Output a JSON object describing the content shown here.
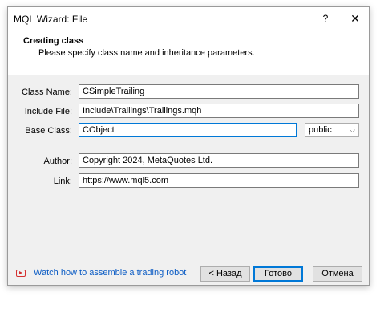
{
  "window": {
    "title": "MQL Wizard: File",
    "help_label": "?",
    "close_label": "✕"
  },
  "header": {
    "title": "Creating class",
    "subtitle": "Please specify class name and inheritance parameters."
  },
  "form": {
    "class_name": {
      "label": "Class Name:",
      "value": "CSimpleTrailing"
    },
    "include_file": {
      "label": "Include File:",
      "value": "Include\\Trailings\\Trailings.mqh"
    },
    "base_class": {
      "label": "Base Class:",
      "value": "CObject"
    },
    "access": {
      "selected": "public"
    },
    "author": {
      "label": "Author:",
      "value": "Copyright 2024, MetaQuotes Ltd."
    },
    "link": {
      "label": "Link:",
      "value": "https://www.mql5.com"
    }
  },
  "footer": {
    "watch_link": "Watch how to assemble a trading robot",
    "back_button": "< Назад",
    "next_button": "Готово",
    "cancel_button": "Отмена"
  },
  "icons": {
    "video": "youtube-play-icon",
    "dropdown": "chevron-down-icon",
    "close": "close-icon",
    "help": "help-icon"
  }
}
